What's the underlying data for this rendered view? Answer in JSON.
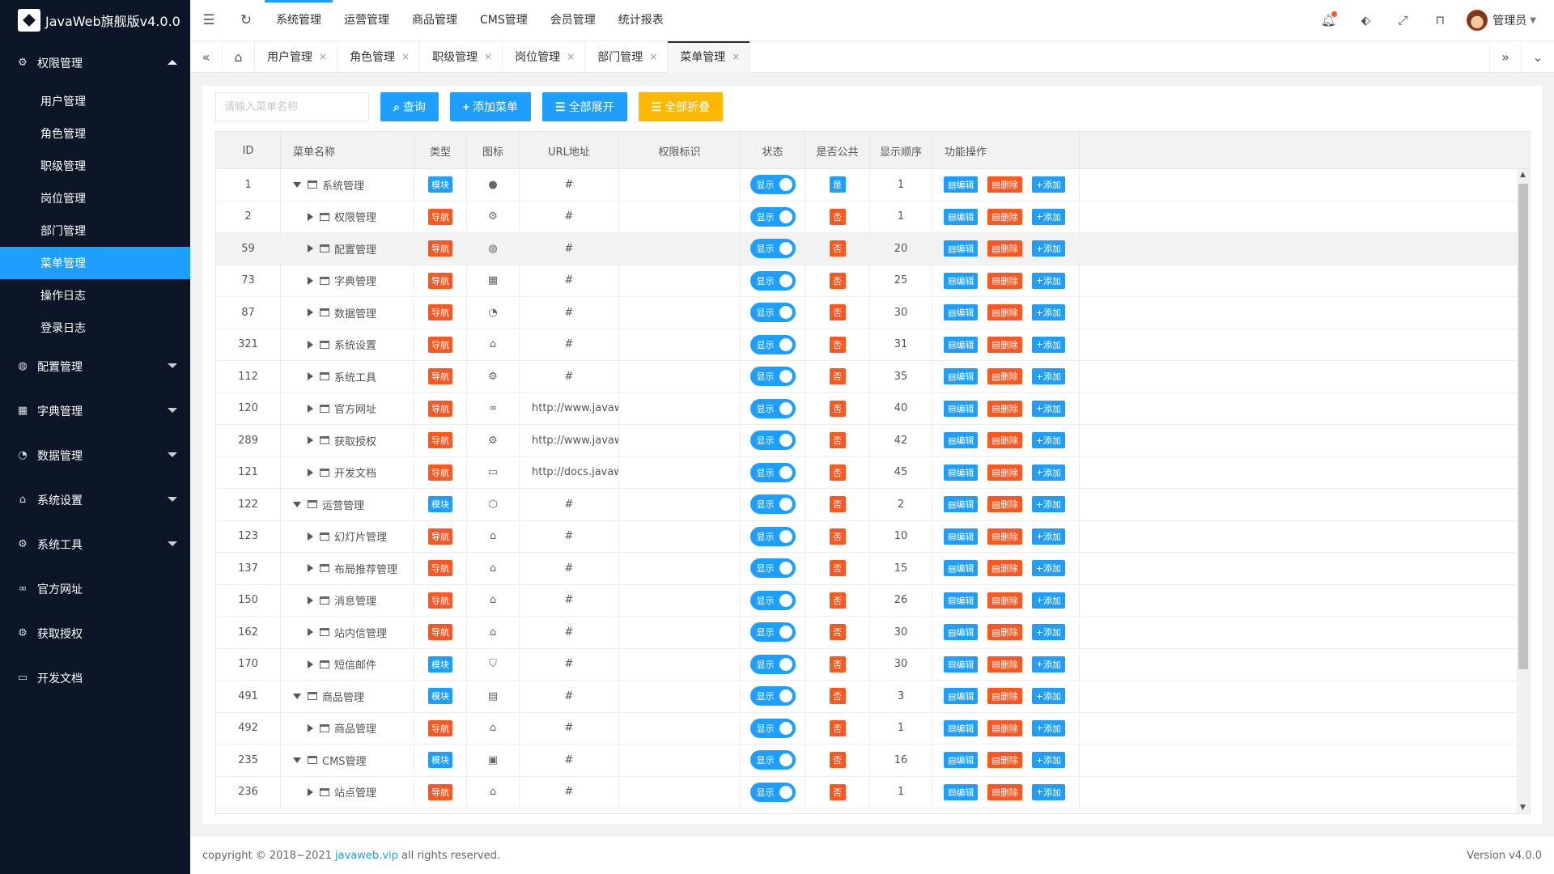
{
  "app": {
    "title": "JavaWeb旗舰版v4.0.0"
  },
  "sidebar": {
    "groups": [
      {
        "label": "权限管理",
        "icon": "gear-icon",
        "expanded": true,
        "items": [
          "用户管理",
          "角色管理",
          "职级管理",
          "岗位管理",
          "部门管理",
          "菜单管理",
          "操作日志",
          "登录日志"
        ]
      },
      {
        "label": "配置管理",
        "icon": "globe-icon",
        "expanded": false
      },
      {
        "label": "字典管理",
        "icon": "apps-icon",
        "expanded": false
      },
      {
        "label": "数据管理",
        "icon": "palette-icon",
        "expanded": false
      },
      {
        "label": "系统设置",
        "icon": "home-icon",
        "expanded": false
      },
      {
        "label": "系统工具",
        "icon": "gear-icon",
        "expanded": false
      },
      {
        "label": "官方网址",
        "icon": "link-icon",
        "expanded": false
      },
      {
        "label": "获取授权",
        "icon": "gear-icon",
        "expanded": false
      },
      {
        "label": "开发文档",
        "icon": "book-icon",
        "expanded": false
      }
    ],
    "active_item": "菜单管理"
  },
  "topnav": {
    "items": [
      "系统管理",
      "运营管理",
      "商品管理",
      "CMS管理",
      "会员管理",
      "统计报表"
    ],
    "active": "系统管理",
    "user": "管理员"
  },
  "tabs": {
    "items": [
      "用户管理",
      "角色管理",
      "职级管理",
      "岗位管理",
      "部门管理",
      "菜单管理"
    ],
    "active": "菜单管理"
  },
  "toolbar": {
    "search_placeholder": "请输入菜单名称",
    "query": "查询",
    "add": "添加菜单",
    "expand_all": "全部展开",
    "collapse_all": "全部折叠"
  },
  "table": {
    "headers": [
      "ID",
      "菜单名称",
      "类型",
      "图标",
      "URL地址",
      "权限标识",
      "状态",
      "是否公共",
      "显示顺序",
      "功能操作"
    ],
    "status_label": "显示",
    "actions": {
      "edit": "编辑",
      "delete": "删除",
      "add": "添加"
    },
    "rows": [
      {
        "id": "1",
        "name": "系统管理",
        "level": 0,
        "type": "模块",
        "icon": "wechat-icon",
        "url": "#",
        "public": "是",
        "order": "1"
      },
      {
        "id": "2",
        "name": "权限管理",
        "level": 1,
        "type": "导航",
        "icon": "gear-icon",
        "url": "#",
        "public": "否",
        "order": "1"
      },
      {
        "id": "59",
        "name": "配置管理",
        "level": 1,
        "type": "导航",
        "icon": "globe-icon",
        "url": "#",
        "public": "否",
        "order": "20"
      },
      {
        "id": "73",
        "name": "字典管理",
        "level": 1,
        "type": "导航",
        "icon": "apps-icon",
        "url": "#",
        "public": "否",
        "order": "25"
      },
      {
        "id": "87",
        "name": "数据管理",
        "level": 1,
        "type": "导航",
        "icon": "palette-icon",
        "url": "#",
        "public": "否",
        "order": "30"
      },
      {
        "id": "321",
        "name": "系统设置",
        "level": 1,
        "type": "导航",
        "icon": "home-icon",
        "url": "#",
        "public": "否",
        "order": "31"
      },
      {
        "id": "112",
        "name": "系统工具",
        "level": 1,
        "type": "导航",
        "icon": "gear-icon",
        "url": "#",
        "public": "否",
        "order": "35"
      },
      {
        "id": "120",
        "name": "官方网址",
        "level": 1,
        "type": "导航",
        "icon": "link-icon",
        "url": "http://www.javaw...",
        "public": "否",
        "order": "40"
      },
      {
        "id": "289",
        "name": "获取授权",
        "level": 1,
        "type": "导航",
        "icon": "gear-icon",
        "url": "http://www.javaw...",
        "public": "否",
        "order": "42"
      },
      {
        "id": "121",
        "name": "开发文档",
        "level": 1,
        "type": "导航",
        "icon": "book-icon",
        "url": "http://docs.javaw...",
        "public": "否",
        "order": "45"
      },
      {
        "id": "122",
        "name": "运营管理",
        "level": 0,
        "type": "模块",
        "icon": "cube-icon",
        "url": "#",
        "public": "否",
        "order": "2"
      },
      {
        "id": "123",
        "name": "幻灯片管理",
        "level": 1,
        "type": "导航",
        "icon": "home-icon",
        "url": "#",
        "public": "否",
        "order": "10"
      },
      {
        "id": "137",
        "name": "布局推荐管理",
        "level": 1,
        "type": "导航",
        "icon": "home-icon",
        "url": "#",
        "public": "否",
        "order": "15"
      },
      {
        "id": "150",
        "name": "消息管理",
        "level": 1,
        "type": "导航",
        "icon": "home-icon",
        "url": "#",
        "public": "否",
        "order": "26"
      },
      {
        "id": "162",
        "name": "站内信管理",
        "level": 1,
        "type": "导航",
        "icon": "home-icon",
        "url": "#",
        "public": "否",
        "order": "30"
      },
      {
        "id": "170",
        "name": "短信邮件",
        "level": 1,
        "type": "模块",
        "icon": "shield-icon",
        "url": "#",
        "public": "否",
        "order": "30"
      },
      {
        "id": "491",
        "name": "商品管理",
        "level": 0,
        "type": "模块",
        "icon": "cards-icon",
        "url": "#",
        "public": "否",
        "order": "3"
      },
      {
        "id": "492",
        "name": "商品管理",
        "level": 1,
        "type": "导航",
        "icon": "home-icon",
        "url": "#",
        "public": "否",
        "order": "1"
      },
      {
        "id": "235",
        "name": "CMS管理",
        "level": 0,
        "type": "模块",
        "icon": "window-icon",
        "url": "#",
        "public": "否",
        "order": "16"
      },
      {
        "id": "236",
        "name": "站点管理",
        "level": 1,
        "type": "导航",
        "icon": "home-icon",
        "url": "#",
        "public": "否",
        "order": "1"
      }
    ]
  },
  "footer": {
    "prefix": "copyright © 2018~2021 ",
    "link": "javaweb.vip",
    "suffix": " all rights reserved.",
    "version": "Version v4.0.0"
  },
  "colors": {
    "primary": "#1e9fff",
    "danger": "#ff5722",
    "warning": "#ffb800",
    "sidebar": "#0d1627"
  }
}
